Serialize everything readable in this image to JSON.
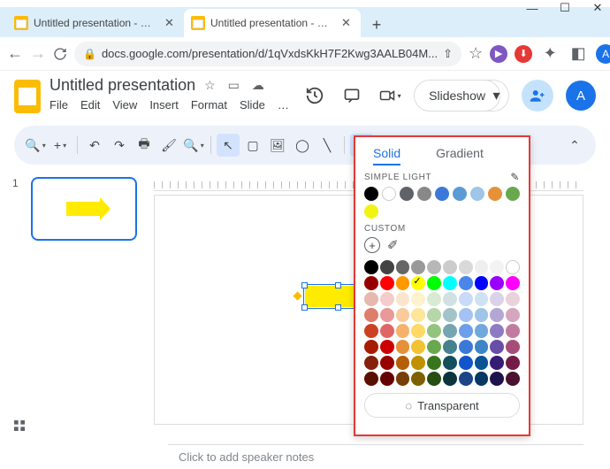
{
  "window": {
    "min": "—",
    "max": "☐",
    "close": "✕"
  },
  "browser": {
    "tabs": [
      {
        "title": "Untitled presentation - Google S"
      },
      {
        "title": "Untitled presentation - Google S"
      }
    ],
    "newtab": "+",
    "back": "←",
    "forward": "→",
    "reload": "⟳",
    "url": "docs.google.com/presentation/d/1qVxdsKkH7F2Kwg3AALB04M...",
    "share_icon": "⇪",
    "star": "☆",
    "profile_letter": "A"
  },
  "slides": {
    "title": "Untitled presentation",
    "menus": [
      "File",
      "Edit",
      "View",
      "Insert",
      "Format",
      "Slide",
      "…"
    ],
    "slideshow": "Slideshow",
    "avatar_letter": "A",
    "font": "Arial"
  },
  "thumb": {
    "num": "1"
  },
  "notes": {
    "placeholder": "Click to add speaker notes"
  },
  "colorpicker": {
    "tab_solid": "Solid",
    "tab_gradient": "Gradient",
    "simple_label": "SIMPLE LIGHT",
    "custom_label": "CUSTOM",
    "transparent": "Transparent",
    "simple_colors": [
      "#000000",
      "#ffffff",
      "#5f6368",
      "#888888",
      "#3c78d8",
      "#5b9bd5",
      "#9fc5e8",
      "#e69138",
      "#6aa84f",
      "#f1f312"
    ],
    "selected_color": "#ffff00",
    "palette": [
      [
        "#000000",
        "#434343",
        "#666666",
        "#999999",
        "#b7b7b7",
        "#cccccc",
        "#d9d9d9",
        "#efefef",
        "#f3f3f3",
        "#ffffff"
      ],
      [
        "#980000",
        "#ff0000",
        "#ff9900",
        "#ffff00",
        "#00ff00",
        "#00ffff",
        "#4a86e8",
        "#0000ff",
        "#9900ff",
        "#ff00ff"
      ],
      [
        "#e6b8af",
        "#f4cccc",
        "#fce5cd",
        "#fff2cc",
        "#d9ead3",
        "#d0e0e3",
        "#c9daf8",
        "#cfe2f3",
        "#d9d2e9",
        "#ead1dc"
      ],
      [
        "#dd7e6b",
        "#ea9999",
        "#f9cb9c",
        "#ffe599",
        "#b6d7a8",
        "#a2c4c9",
        "#a4c2f4",
        "#9fc5e8",
        "#b4a7d6",
        "#d5a6bd"
      ],
      [
        "#cc4125",
        "#e06666",
        "#f6b26b",
        "#ffd966",
        "#93c47d",
        "#76a5af",
        "#6d9eeb",
        "#6fa8dc",
        "#8e7cc3",
        "#c27ba0"
      ],
      [
        "#a61c00",
        "#cc0000",
        "#e69138",
        "#f1c232",
        "#6aa84f",
        "#45818e",
        "#3c78d8",
        "#3d85c6",
        "#674ea7",
        "#a64d79"
      ],
      [
        "#85200c",
        "#990000",
        "#b45f06",
        "#bf9000",
        "#38761d",
        "#134f5c",
        "#1155cc",
        "#0b5394",
        "#351c75",
        "#741b47"
      ],
      [
        "#5b0f00",
        "#660000",
        "#783f04",
        "#7f6000",
        "#274e13",
        "#0c343d",
        "#1c4587",
        "#073763",
        "#20124d",
        "#4c1130"
      ]
    ]
  }
}
